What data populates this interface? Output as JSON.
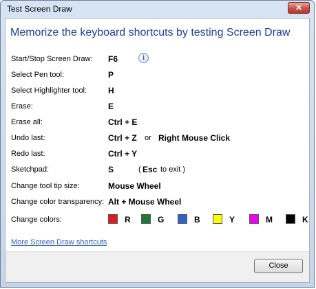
{
  "window": {
    "title": "Test Screen Draw",
    "close_glyph": "✕"
  },
  "heading": "Memorize the keyboard shortcuts by testing Screen Draw",
  "shortcuts": [
    {
      "label": "Start/Stop Screen Draw:",
      "key": "F6"
    },
    {
      "label": "Select Pen tool:",
      "key": "P"
    },
    {
      "label": "Select Highlighter tool:",
      "key": "H"
    },
    {
      "label": "Erase:",
      "key": "E"
    },
    {
      "label": "Erase all:",
      "key": "Ctrl + E"
    },
    {
      "label": "Undo last:",
      "key": "Ctrl + Z",
      "or_text": "or",
      "alt_key": "Right Mouse Click"
    },
    {
      "label": "Redo last:",
      "key": "Ctrl + Y"
    },
    {
      "label": "Sketchpad:",
      "key": "S",
      "paren_open": "(",
      "esc_key": "Esc",
      "esc_text": "to exit )"
    },
    {
      "label": "Change tool tip size:",
      "key": "Mouse Wheel"
    },
    {
      "label": "Change color transparency:",
      "key": "Alt + Mouse Wheel"
    }
  ],
  "colors": {
    "label": "Change colors:",
    "items": [
      {
        "letter": "R",
        "color": "#e3191d"
      },
      {
        "letter": "G",
        "color": "#1f7b34"
      },
      {
        "letter": "B",
        "color": "#2e64c6"
      },
      {
        "letter": "Y",
        "color": "#fbff00"
      },
      {
        "letter": "M",
        "color": "#f200f2"
      },
      {
        "letter": "K",
        "color": "#000000"
      }
    ]
  },
  "link_text": "More Screen Draw shortcuts",
  "close_button": "Close",
  "info_glyph": "i"
}
